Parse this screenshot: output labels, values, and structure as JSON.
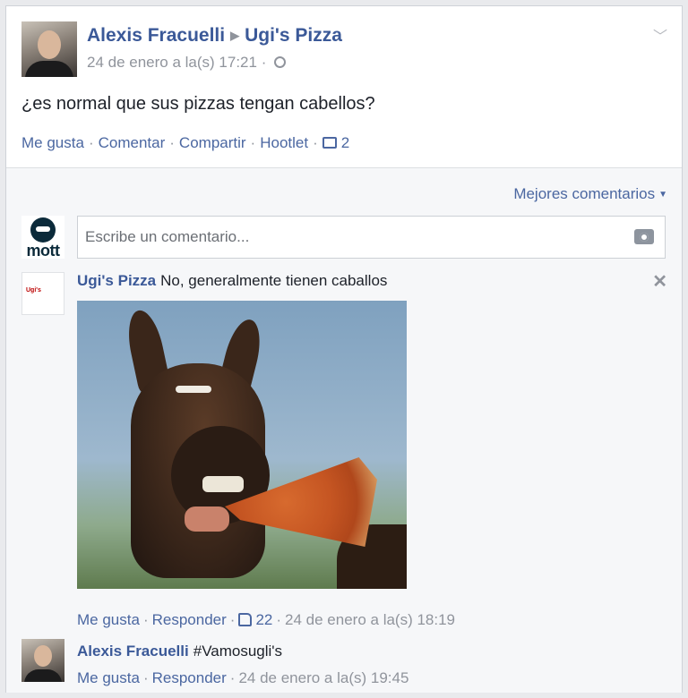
{
  "post": {
    "author": "Alexis Fracuelli",
    "target_page": "Ugi's Pizza",
    "timestamp": "24 de enero a la(s) 17:21",
    "visibility_separator": "·",
    "text": "¿es normal que sus pizzas tengan cabellos?",
    "actions": {
      "like": "Me gusta",
      "comment": "Comentar",
      "share": "Compartir",
      "hootlet": "Hootlet",
      "comment_count": "2"
    }
  },
  "comments_section": {
    "sort_label": "Mejores comentarios",
    "composer_placeholder": "Escribe un comentario...",
    "composer_avatar_text": "mott",
    "page_logo_text": "Ugi's"
  },
  "comments": [
    {
      "author": "Ugi's Pizza",
      "text": "No, generalmente tienen caballos",
      "like_label": "Me gusta",
      "reply_label": "Responder",
      "likes": "22",
      "time": "24 de enero a la(s) 18:19"
    },
    {
      "author": "Alexis Fracuelli",
      "text": "#Vamosugli's",
      "like_label": "Me gusta",
      "reply_label": "Responder",
      "time": "24 de enero a la(s) 19:45"
    }
  ],
  "icons": [
    "chevron-down-icon",
    "globe-icon",
    "comment-icon",
    "camera-icon",
    "close-icon",
    "thumbs-up-icon"
  ],
  "colors": {
    "link": "#3b5998",
    "action": "#4b67a1",
    "meta": "#90949c",
    "background": "#e9eaed"
  }
}
